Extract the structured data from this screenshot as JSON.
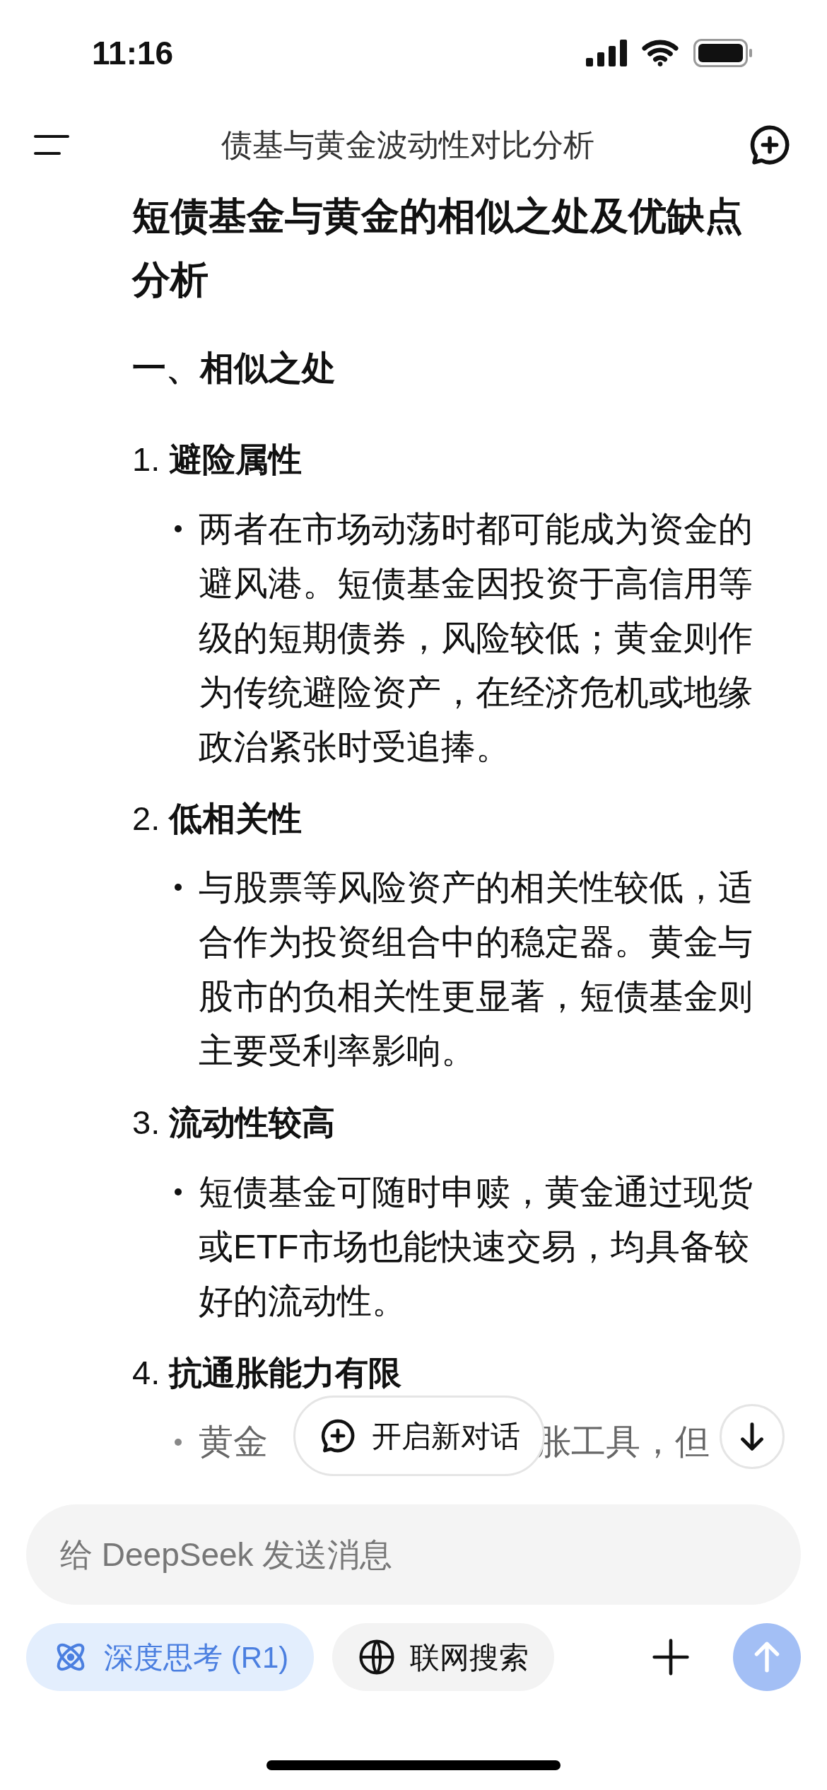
{
  "status_bar": {
    "time": "11:16"
  },
  "header": {
    "title": "债基与黄金波动性对比分析"
  },
  "article": {
    "title": "短债基金与黄金的相似之处及优缺点分析",
    "section": "一、相似之处",
    "items": [
      {
        "number": "1.",
        "heading": "避险属性",
        "bullets": [
          "两者在市场动荡时都可能成为资金的避风港。短债基金因投资于高信用等级的短期债券，风险较低；黄金则作为传统避险资产，在经济危机或地缘政治紧张时受追捧。"
        ]
      },
      {
        "number": "2.",
        "heading": "低相关性",
        "bullets": [
          "与股票等风险资产的相关性较低，适合作为投资组合中的稳定器。黄金与股市的负相关性更显著，短债基金则主要受利率影响。"
        ]
      },
      {
        "number": "3.",
        "heading": "流动性较高",
        "bullets": [
          "短债基金可随时申赎，黄金通过现货或ETF市场也能快速交易，均具备较好的流动性。"
        ]
      },
      {
        "number": "4.",
        "heading": "抗通胀能力有限",
        "partial_bullet": [
          "黄金",
          "胀工具，但"
        ]
      }
    ]
  },
  "floating": {
    "new_chat": "开启新对话"
  },
  "composer": {
    "placeholder": "给 DeepSeek 发送消息",
    "chips": [
      {
        "kind": "deep_think",
        "label": "深度思考 (R1)",
        "selected": true
      },
      {
        "kind": "web_search",
        "label": "联网搜索",
        "selected": false
      }
    ]
  }
}
